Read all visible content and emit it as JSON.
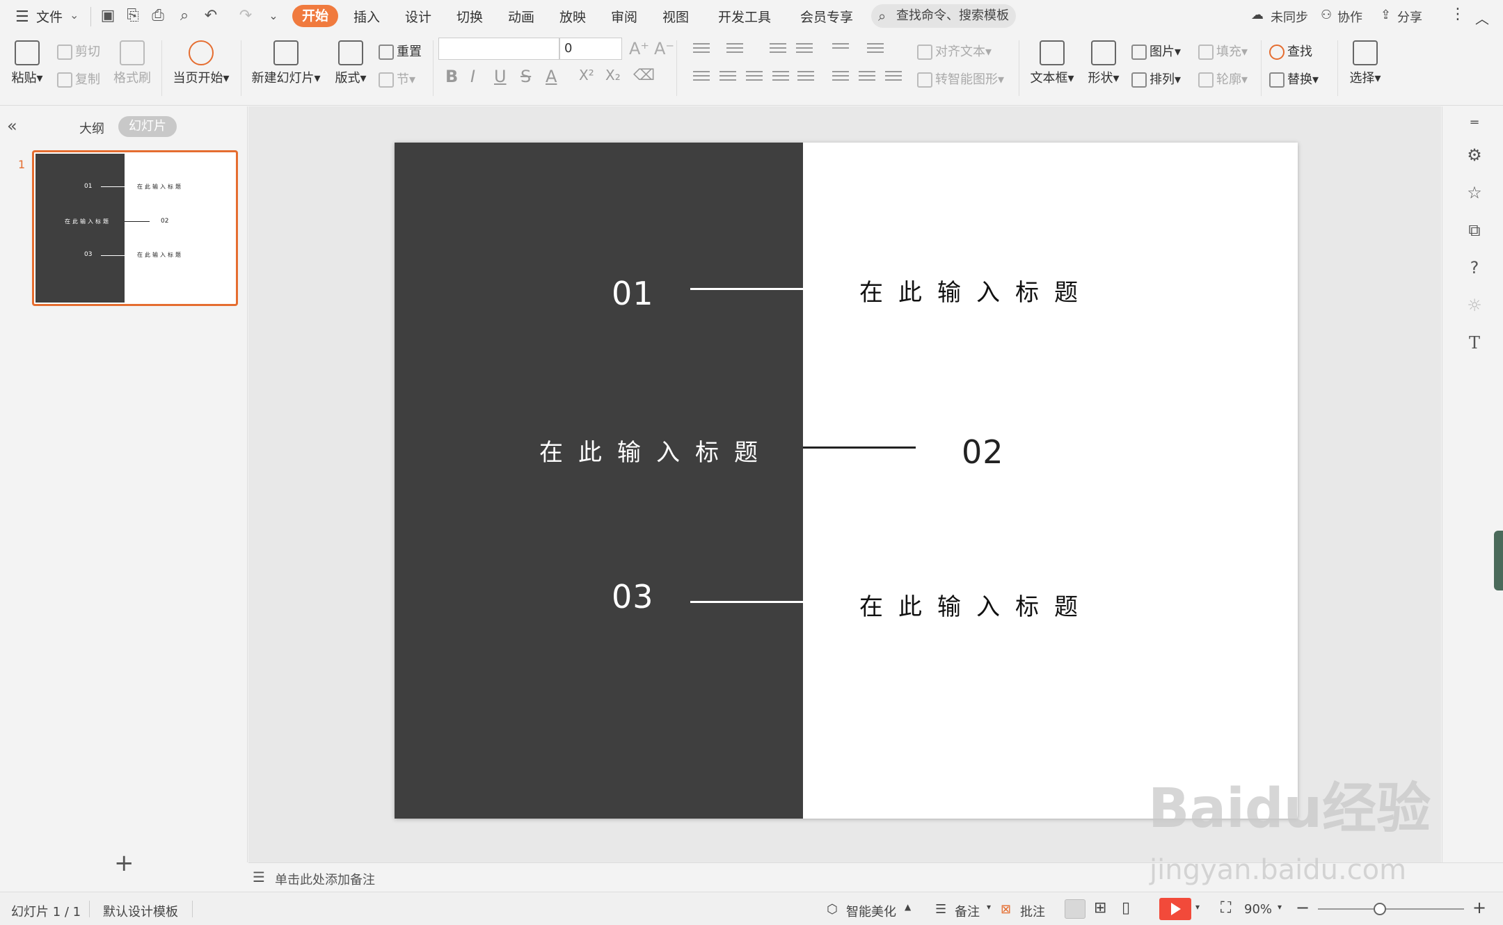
{
  "menubar": {
    "file": "文件",
    "tabs": [
      "开始",
      "插入",
      "设计",
      "切换",
      "动画",
      "放映",
      "审阅",
      "视图",
      "开发工具",
      "会员专享"
    ],
    "active_tab": "开始",
    "search_placeholder": "查找命令、搜索模板",
    "sync": "未同步",
    "collab": "协作",
    "share": "分享"
  },
  "ribbon": {
    "paste": "粘贴",
    "cut": "剪切",
    "copy": "复制",
    "format_painter": "格式刷",
    "from_current": "当页开始",
    "new_slide": "新建幻灯片",
    "layout": "版式",
    "reset": "重置",
    "section": "节",
    "font_name": "",
    "font_size": "0",
    "align_text": "对齐文本",
    "smart_shape": "转智能图形",
    "textbox": "文本框",
    "shape": "形状",
    "picture": "图片",
    "fill": "填充",
    "arrange": "排列",
    "outline": "轮廓",
    "find": "查找",
    "replace": "替换",
    "select": "选择"
  },
  "leftpanel": {
    "outline_tab": "大纲",
    "slides_tab": "幻灯片",
    "slide_number": "1"
  },
  "slide": {
    "items": [
      {
        "number": "01",
        "title": "在此输入标题"
      },
      {
        "number": "02",
        "title": "在此输入标题"
      },
      {
        "number": "03",
        "title": "在此输入标题"
      }
    ],
    "colors": {
      "dark_panel": "#3f3f3f",
      "light_panel": "#ffffff",
      "accent_border": "#e56d30"
    }
  },
  "notes": {
    "placeholder": "单击此处添加备注"
  },
  "statusbar": {
    "slide_count": "幻灯片 1 / 1",
    "template": "默认设计模板",
    "beautify": "智能美化",
    "notes": "备注",
    "comments": "批注",
    "zoom": "90%"
  },
  "watermark": {
    "brand": "Baidu经验",
    "url": "jingyan.baidu.com"
  }
}
